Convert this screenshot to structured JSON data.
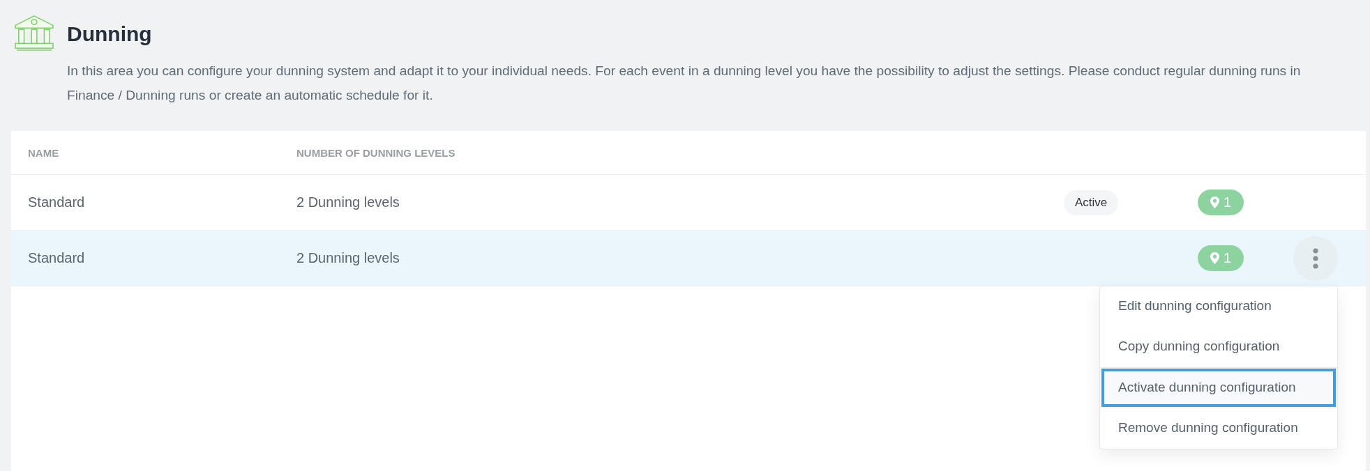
{
  "header": {
    "title": "Dunning",
    "description": "In this area you can configure your dunning system and adapt it to your individual needs. For each event in a dunning level you have the possibility to adjust the settings. Please conduct regular dunning runs in Finance / Dunning runs or create an automatic schedule for it."
  },
  "table": {
    "columns": [
      "NAME",
      "NUMBER OF DUNNING LEVELS"
    ],
    "rows": [
      {
        "name": "Standard",
        "levels": "2 Dunning levels",
        "status": "Active",
        "location_count": "1",
        "selected": false,
        "menu_button": false
      },
      {
        "name": "Standard",
        "levels": "2 Dunning levels",
        "location_count": "1",
        "selected": true,
        "menu_button": true
      }
    ]
  },
  "menu": {
    "items": [
      {
        "label": "Edit dunning configuration",
        "focused": false
      },
      {
        "label": "Copy dunning configuration",
        "focused": false
      },
      {
        "label": "Activate dunning configuration",
        "focused": true
      },
      {
        "label": "Remove dunning configuration",
        "focused": false
      }
    ]
  }
}
